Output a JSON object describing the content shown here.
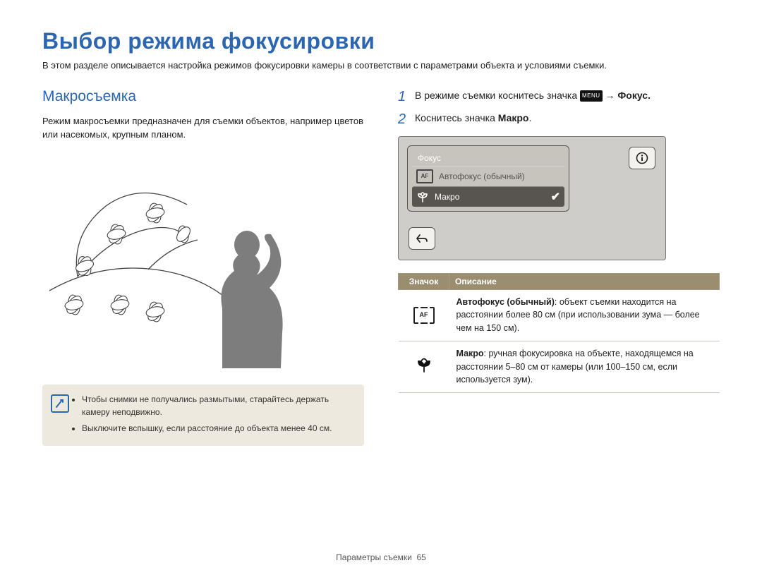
{
  "title": "Выбор режима фокусировки",
  "intro": "В этом разделе описывается настройка режимов фокусировки камеры в соответствии с параметрами объекта и условиями съемки.",
  "left": {
    "subhead": "Макросъемка",
    "body": "Режим макросъемки предназначен для съемки объектов, например цветов или насекомых, крупным планом.",
    "notes": [
      "Чтобы снимки не получались размытыми, старайтесь держать камеру неподвижно.",
      "Выключите вспышку, если расстояние до объекта менее 40 см."
    ]
  },
  "right": {
    "step1_pre": "В режиме съемки коснитесь значка",
    "step1_menu": "MENU",
    "step1_post": "→ Фокус.",
    "step2_pre": "Коснитесь значка ",
    "step2_bold": "Макро",
    "step2_post": ".",
    "lcd": {
      "title": "Фокус",
      "row_af": "Автофокус (обычный)",
      "row_macro": "Макро"
    },
    "table": {
      "th_icon": "Значок",
      "th_desc": "Описание",
      "af_label": "AF",
      "row1_bold": "Автофокус (обычный)",
      "row1_text": ": объект съемки находится на расстоянии более 80 см (при использовании зума — более чем на 150 см).",
      "row2_bold": "Макро",
      "row2_text": ": ручная фокусировка на объекте, находящемся на расстоянии 5–80 см от камеры (или 100–150 см, если используется зум)."
    }
  },
  "footer_label": "Параметры съемки",
  "footer_page": "65"
}
